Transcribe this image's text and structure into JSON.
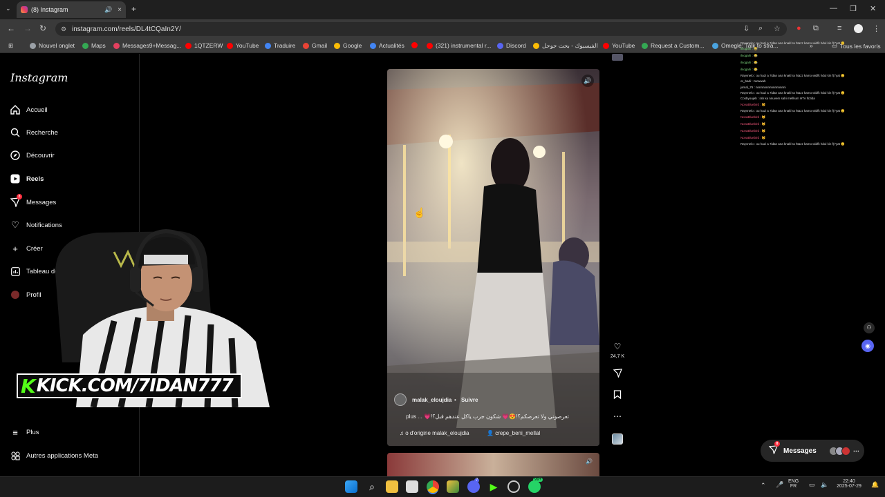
{
  "browser": {
    "tab_title": "(8) Instagram",
    "url": "instagram.com/reels/DL4tCQaIn2Y/",
    "bookmarks": [
      "Nouvel onglet",
      "Maps",
      "Messages9+Messag...",
      "1QTZERW",
      "YouTube",
      "Traduire",
      "Gmail",
      "Google",
      "Actualités",
      "(321) instrumental r...",
      "Discord",
      "الفيسبوك - بحث جوجل",
      "YouTube",
      "Request a Custom...",
      "Omegle: Talk to stra..."
    ],
    "all_bookmarks": "Tous les favoris",
    "tab_close": "×",
    "new_tab": "+"
  },
  "instagram": {
    "logo": "Instagram",
    "nav": [
      {
        "label": "Accueil",
        "icon": "home-icon"
      },
      {
        "label": "Recherche",
        "icon": "search-icon"
      },
      {
        "label": "Découvrir",
        "icon": "compass-icon"
      },
      {
        "label": "Reels",
        "icon": "reels-icon"
      },
      {
        "label": "Messages",
        "icon": "messenger-icon"
      },
      {
        "label": "Notifications",
        "icon": "heart-icon"
      },
      {
        "label": "Créer",
        "icon": "plus-icon"
      },
      {
        "label": "Tableau de bord",
        "icon": "dashboard-icon"
      },
      {
        "label": "Profil",
        "icon": "avatar-icon"
      }
    ],
    "more": "Plus",
    "meta_apps": "Autres applications Meta",
    "messages_badge": "8",
    "messages_pill": "Messages"
  },
  "overlay": {
    "kick_k": "K",
    "kick_text": "KICK.COM/7IDAN777"
  },
  "reel": {
    "username": "malak_eloujdia",
    "follow": "Suivre",
    "caption": "تعرصوني ولا تعرصكم؟!😍💗 شكون جرب ياكل عندهم قبل؟!💗 ... plus",
    "audio": "o d'origine  malak_eloujdia",
    "tag": "crepe_beni_mellal",
    "likes": "24,7 K"
  },
  "chat": [
    "Rayvnelo : ou hazi a 7idan ana knakl ra htazz kamo widfk hdul kin f(7yat 😊",
    "ilsogahi : 😂",
    "ilsogahi : 😂",
    "ilsogahi : 😂",
    "ilsogahi : 😂",
    "Rayvnelo : ou hazi a 7idan ana knakl ra htazz kamo widfk hdul kin f(7yat 😊",
    "or_badi : zarwwah",
    "jamal_76 : nnnnnnnnnnnnnnnnni",
    "Rayvnelo : ou hazi a 7idan ana knakl ra htazz kamo widfk hdul kin f(7yat 😊",
    "Cosbyoujeb : rah ka nnuvem sahi mellkum HTA fs3ida",
    "NovaBluebird : 🐱",
    "Rayvnelo : ou hazi a 7idan ana knakl ra htazz kamo widfk hdul kin f(7yat 😊",
    "NovaBluebird : 🐱",
    "NovaBluebird : 🐱",
    "NovaBluebird : 🐱",
    "NovaBluebird : 🐱",
    "Rayvnelo : ou hazi a 7idan ana knakl ra htazz kamo widfk hdul kin f(7yat 😊"
  ],
  "taskbar": {
    "badge_99": "99+",
    "badge_7": "7",
    "lang": "ENG",
    "lang2": "FR",
    "time": "22:40",
    "date": "2025-07-29"
  },
  "colors": {
    "accent_red": "#ff3040",
    "kick_green": "#53fc18",
    "chrome_dark": "#1f1f1f"
  }
}
